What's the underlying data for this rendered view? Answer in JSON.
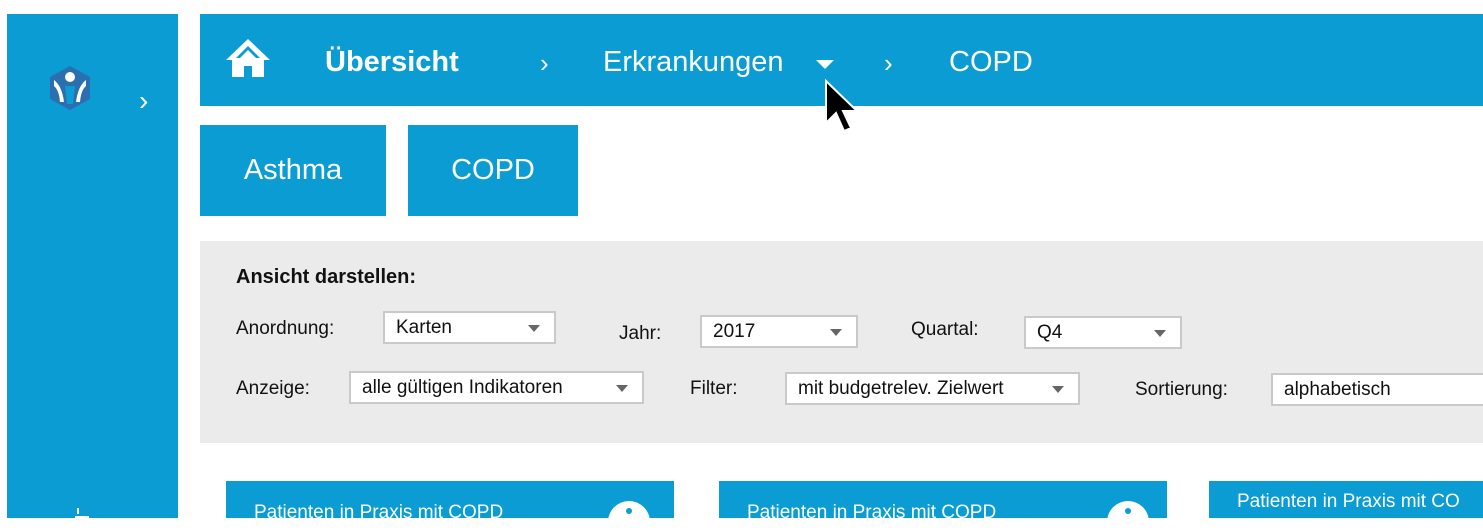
{
  "colors": {
    "brand_blue": "#0a9cd2",
    "panel_bg": "#ebebeb",
    "white": "#ffffff"
  },
  "sidebar": {
    "logo_icon": "person-logo-icon",
    "expand_icon": "chevron-right-icon",
    "expand_glyph": "›",
    "list_icon": "list-icon"
  },
  "breadcrumb": {
    "home_icon": "home-icon",
    "items": [
      {
        "label": "Übersicht"
      },
      {
        "label": "Erkrankungen",
        "has_dropdown": true
      },
      {
        "label": "COPD"
      }
    ],
    "separator": "›"
  },
  "tabs": [
    {
      "label": "Asthma"
    },
    {
      "label": "COPD"
    }
  ],
  "filters": {
    "title": "Ansicht darstellen:",
    "anordnung": {
      "label": "Anordnung:",
      "value": "Karten"
    },
    "jahr": {
      "label": "Jahr:",
      "value": "2017"
    },
    "quartal": {
      "label": "Quartal:",
      "value": "Q4"
    },
    "anzeige": {
      "label": "Anzeige:",
      "value": "alle gültigen Indikatoren"
    },
    "filter": {
      "label": "Filter:",
      "value": "mit budgetrelev. Zielwert"
    },
    "sortierung": {
      "label": "Sortierung:",
      "value": "alphabetisch"
    }
  },
  "cards": [
    {
      "title": "Patienten in Praxis mit COPD"
    },
    {
      "title": "Patienten in Praxis mit COPD"
    },
    {
      "title": "Patienten in Praxis mit CO"
    }
  ]
}
